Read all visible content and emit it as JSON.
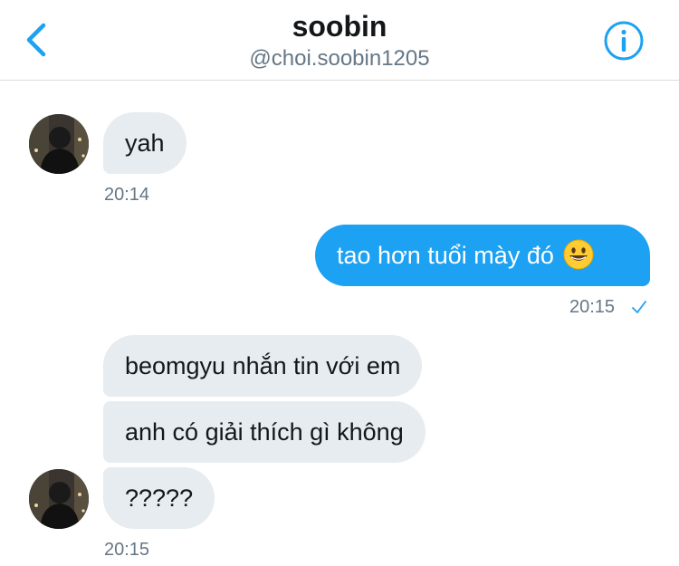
{
  "header": {
    "title": "soobin",
    "handle": "@choi.soobin1205",
    "back_icon": "chevron-left-icon",
    "info_icon": "info-circle-icon",
    "accent": "#1da1f2"
  },
  "messages": [
    {
      "direction": "incoming",
      "text": "yah"
    },
    {
      "direction": "outgoing",
      "text": "tao hơn tuổi mày đó",
      "emoji": "grinning-face-emoji"
    },
    {
      "direction": "incoming",
      "text": "beomgyu nhắn tin với em"
    },
    {
      "direction": "incoming",
      "text": "anh có giải thích gì không"
    },
    {
      "direction": "incoming",
      "text": "?????"
    }
  ],
  "timestamps": {
    "first": "20:14",
    "second": "20:15",
    "third": "20:15"
  },
  "colors": {
    "incoming_bubble": "#e6ecf0",
    "outgoing_bubble": "#1da1f2",
    "timestamp": "#657786"
  }
}
